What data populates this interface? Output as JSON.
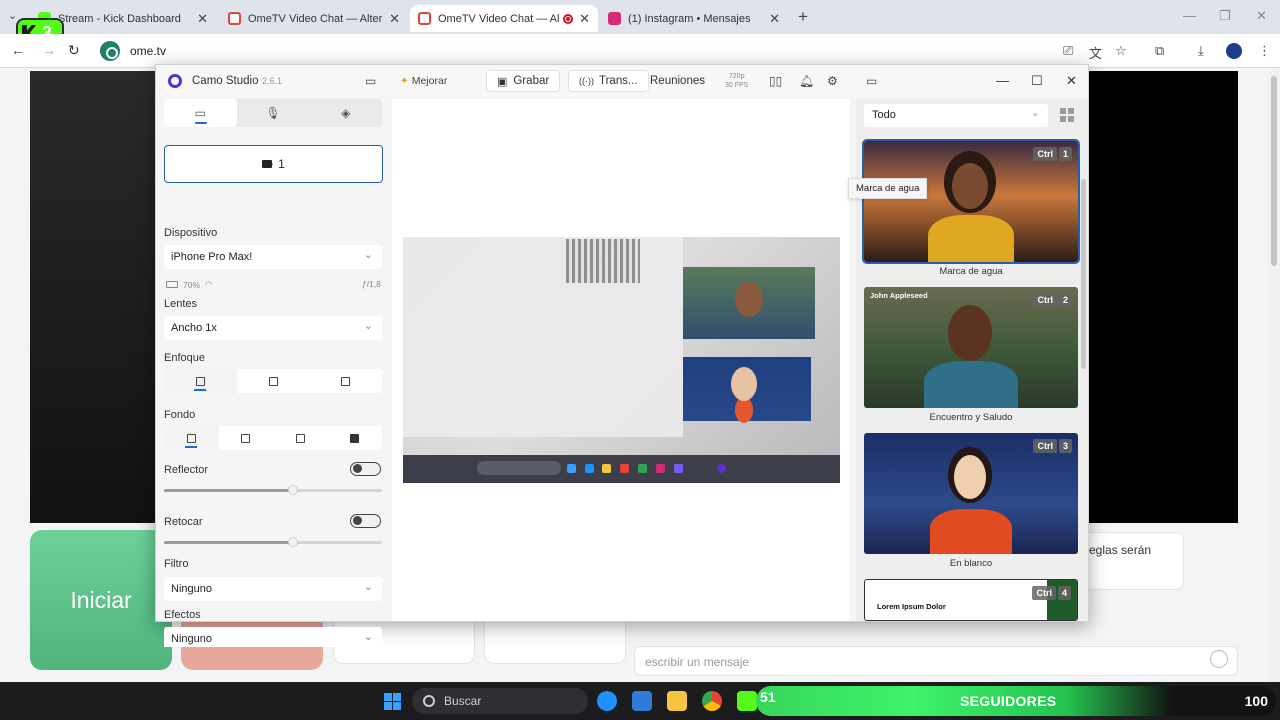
{
  "browser": {
    "tabs": [
      {
        "title": "Stream - Kick Dashboard",
        "favicon_color": "#53fc18"
      },
      {
        "title": "OmeTV Video Chat — Alternati",
        "favicon_color": "#e0443a"
      },
      {
        "title": "OmeTV Video Chat — Alter",
        "favicon_color": "#e0443a",
        "active": true,
        "recording": true
      },
      {
        "title": "(1) Instagram • Mensajes",
        "favicon_color": "#d62976"
      }
    ],
    "url": "ome.tv",
    "kick_badge": "3"
  },
  "ometv": {
    "start_label": "Iniciar",
    "rules_text": "eglas serán",
    "message_placeholder": "escribir un mensaje"
  },
  "camo": {
    "app_name": "Camo Studio",
    "version": "2.6.1",
    "toolbar": {
      "enhance": "Mejorar",
      "record": "Grabar",
      "stream": "Trans...",
      "meetings": "Reuniones",
      "resolution": "720p",
      "fps": "30 FPS"
    },
    "left": {
      "camera_label": "1",
      "device_label": "Dispositivo",
      "device_value": "iPhone Pro Max!",
      "battery": "70%",
      "aperture": "ƒ/1,8",
      "lens_label": "Lentes",
      "lens_value": "Ancho 1x",
      "focus_label": "Enfoque",
      "background_label": "Fondo",
      "spotlight_label": "Reflector",
      "spotlight_level": 0.59,
      "retouch_label": "Retocar",
      "retouch_level": 0.59,
      "filter_label": "Filtro",
      "filter_value": "Ninguno",
      "effects_label": "Efectos",
      "effects_value": "Ninguno"
    },
    "library": {
      "filter": "Todo",
      "tooltip": "Marca de agua",
      "scenes": [
        {
          "name": "Marca de agua",
          "ctrl": "Ctrl",
          "key": "1"
        },
        {
          "name": "Encuentro y Saludo",
          "ctrl": "Ctrl",
          "key": "2",
          "overlay_name": "John Appleseed"
        },
        {
          "name": "En blanco",
          "ctrl": "Ctrl",
          "key": "3"
        },
        {
          "name": "",
          "ctrl": "Ctrl",
          "key": "4",
          "overlay_text": "Lorem Ipsum Dolor"
        }
      ]
    }
  },
  "taskbar": {
    "search_placeholder": "Buscar",
    "followers_current": "51",
    "followers_label": "SEGUIDORES",
    "followers_goal": "100"
  }
}
